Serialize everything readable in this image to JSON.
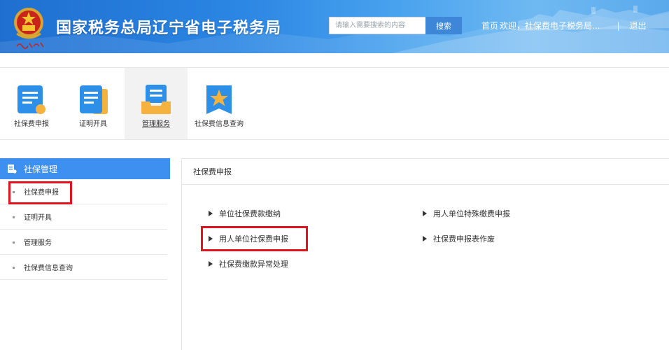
{
  "header": {
    "site_title": "国家税务总局辽宁省电子税务局",
    "search_placeholder": "请输入需要搜索的内容",
    "search_button": "搜索",
    "home_link": "首页",
    "welcome": "欢迎，社保费电子税务局...",
    "separator": "|",
    "logout": "退出"
  },
  "topnav": {
    "items": [
      {
        "label": "社保费申报",
        "icon": "document-icon"
      },
      {
        "label": "证明开具",
        "icon": "certificate-icon"
      },
      {
        "label": "管理服务",
        "icon": "inbox-icon"
      },
      {
        "label": "社保费信息查询",
        "icon": "star-badge-icon"
      }
    ],
    "active": "管理服务"
  },
  "sidebar": {
    "header": "社保管理",
    "items": [
      {
        "label": "社保费申报"
      },
      {
        "label": "证明开具"
      },
      {
        "label": "管理服务"
      },
      {
        "label": "社保费信息查询"
      }
    ]
  },
  "main": {
    "title": "社保费申报",
    "actions": [
      {
        "label": "单位社保费款缴纳"
      },
      {
        "label": "用人单位特殊缴费申报"
      },
      {
        "label": "用人单位社保费申报"
      },
      {
        "label": "社保费申报表作废"
      },
      {
        "label": "社保费缴款异常处理"
      }
    ]
  },
  "colors": {
    "header_blue": "#2a85e3",
    "sidebar_header": "#3d8ff0",
    "highlight_red": "#e0141e",
    "search_button": "#3d86d8"
  }
}
